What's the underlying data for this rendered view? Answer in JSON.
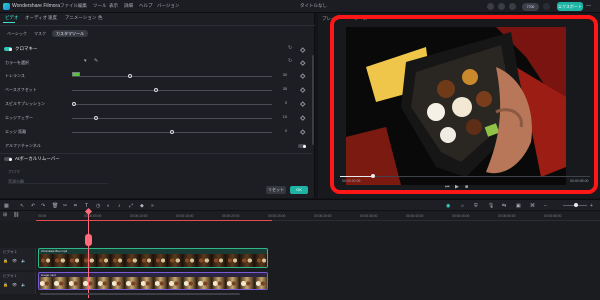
{
  "titlebar": {
    "app_name": "Wondershare Filmora",
    "menus": [
      "ファイル",
      "編集",
      "ツール",
      "表示",
      "詳細",
      "ヘルプ",
      "バージョン"
    ],
    "doc_title": "タイトルなし",
    "badge": "7700",
    "export_label": "エクスポート"
  },
  "panel": {
    "tabs": [
      "ビデオ",
      "オーディオ",
      "速度",
      "アニメーション",
      "色"
    ],
    "subtabs": [
      "ベーシック",
      "マスク",
      "カスタマツール"
    ],
    "chroma_title": "クロマキー",
    "color_label": "カラーを選択",
    "sliders": [
      {
        "label": "トレランス",
        "value": "30",
        "pos": 0.28
      },
      {
        "label": "ベースオフセット",
        "value": "35",
        "pos": 0.41
      },
      {
        "label": "スピルサプレッション",
        "value": "0",
        "pos": 0.0
      },
      {
        "label": "エッジフェザー",
        "value": "10",
        "pos": 0.12
      },
      {
        "label": "エッジ 距離",
        "value": "0",
        "pos": 0.5
      }
    ],
    "alpha_label": "アルファチャンネル",
    "ai_title": "AIボーカルリムーバー",
    "ai_sub1": "クロマ",
    "ai_sub2": "音源分離",
    "reset_label": "リセット",
    "ok_label": "OK"
  },
  "preview": {
    "header_left": "プレイヤー",
    "header_right": "ソース",
    "time_current": "00:00:00:05",
    "time_total": "00:00:05:00"
  },
  "timeline": {
    "ruler": [
      "00:00",
      "00:00:05:00",
      "00:00:10:00",
      "00:00:15:00",
      "00:00:20:00",
      "00:00:25:00",
      "00:00:30:00",
      "00:00:35:00",
      "00:00:40:00",
      "00:00:45:00",
      "00:00:50:00",
      "00:00:55:00"
    ],
    "track1_name": "ビデオ 2",
    "track2_name": "ビデオ 1",
    "clip1_label": "Chocolate Box.mp4",
    "clip2_label": "image.mp4"
  }
}
